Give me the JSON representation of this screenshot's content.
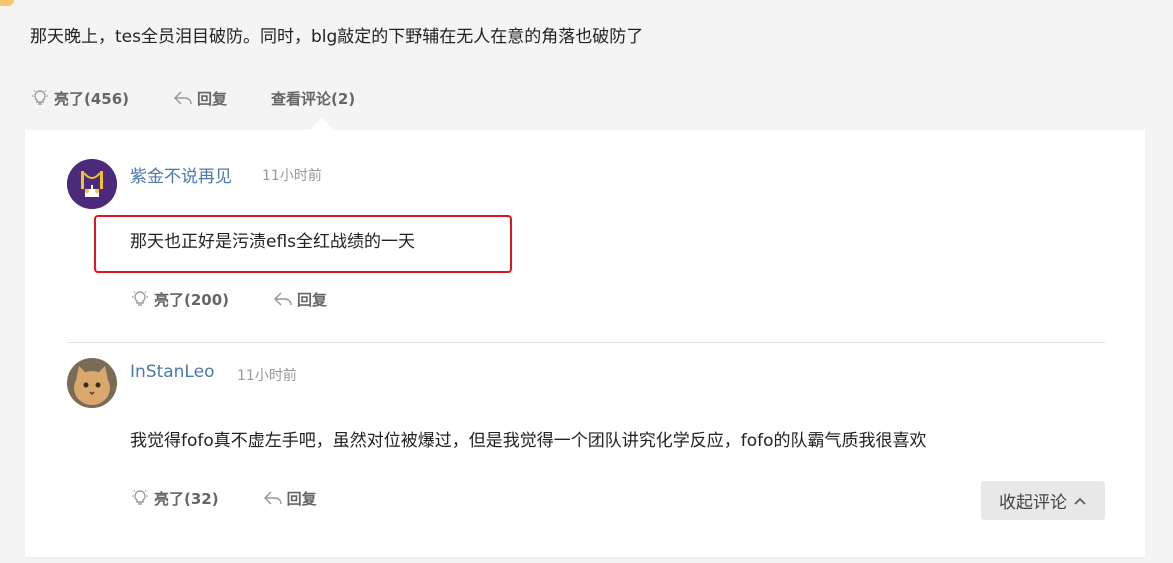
{
  "post": {
    "text": "那天晚上，tes全员泪目破防。同时，blg敲定的下野辅在无人在意的角落也破防了",
    "like_label": "亮了(456)",
    "reply_label": "回复",
    "view_comments_label": "查看评论(2)"
  },
  "comments": [
    {
      "username": "紫金不说再见",
      "time": "11小时前",
      "text": "那天也正好是污渍efls全红战绩的一天",
      "like_label": "亮了(200)",
      "reply_label": "回复"
    },
    {
      "username": "InStanLeo",
      "time": "11小时前",
      "text": "我觉得fofo真不虚左手吧，虽然对位被爆过，但是我觉得一个团队讲究化学反应，fofo的队霸气质我很喜欢",
      "like_label": "亮了(32)",
      "reply_label": "回复"
    }
  ],
  "collapse_label": "收起评论",
  "colors": {
    "username": "#4a78b0",
    "highlight_border": "#e0141e",
    "action_text": "#666666"
  },
  "icons": {
    "like": "lightbulb-icon",
    "reply": "reply-arrow-icon",
    "collapse": "chevron-up-icon"
  }
}
